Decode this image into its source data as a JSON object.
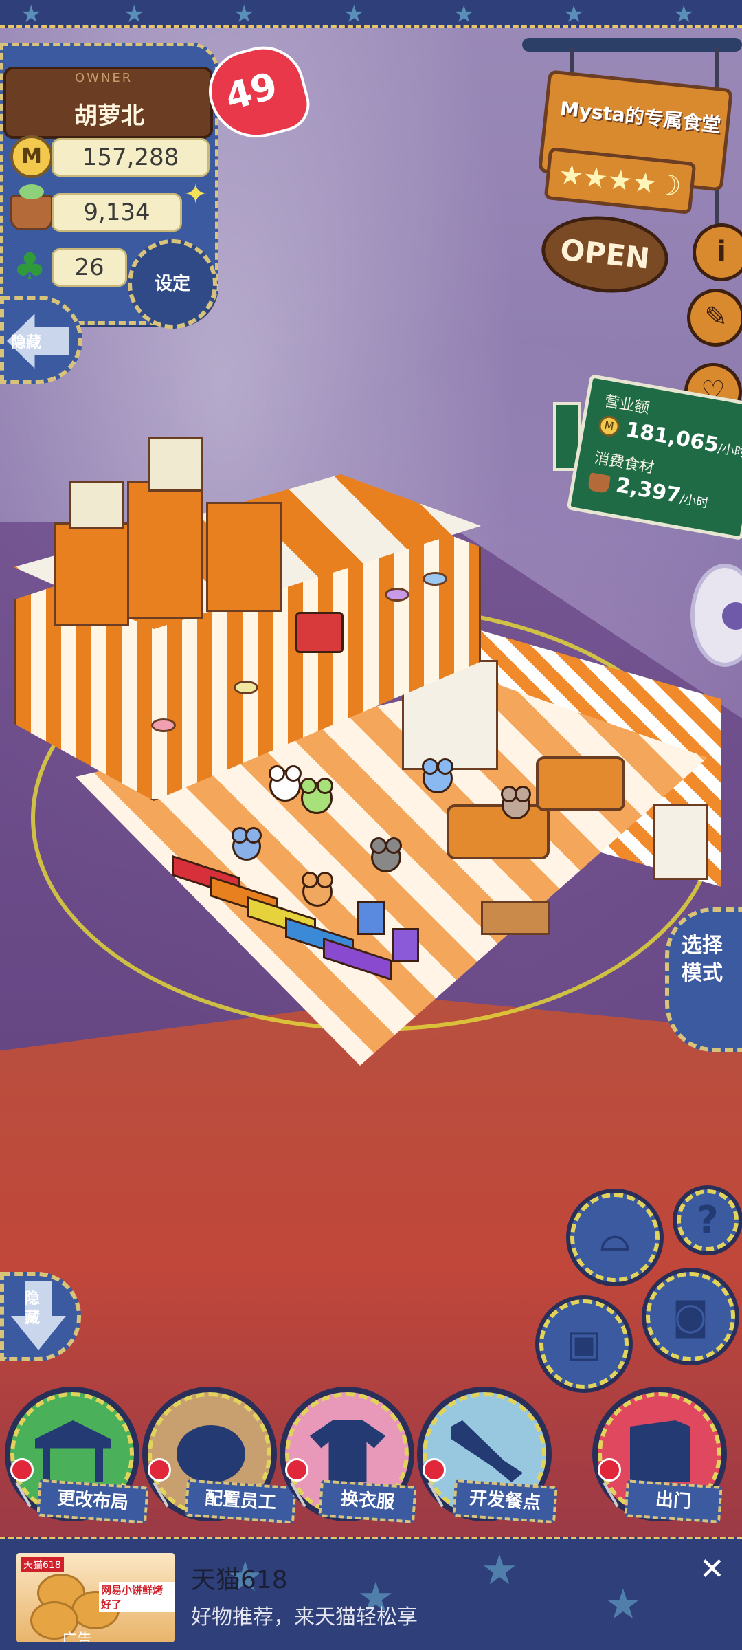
{
  "owner": {
    "label": "OWNER",
    "name": "胡萝北",
    "level": "49",
    "coins": "157,288",
    "ingredients": "9,134",
    "clovers": "26",
    "settings_label": "设定",
    "hide_label": "隐藏"
  },
  "restaurant": {
    "sign_title": "Mysta的专属食堂",
    "stars": "★★★★☽",
    "open_label": "OPEN"
  },
  "revenue": {
    "sales_label": "营业额",
    "sales_value": "181,065",
    "sales_unit": "/小时",
    "consume_label": "消费食材",
    "consume_value": "2,397",
    "consume_unit": "/小时"
  },
  "side_buttons": {
    "info": "i",
    "recipe": "✎",
    "heart": "♡"
  },
  "mode": {
    "label": "选择模式"
  },
  "bottom": {
    "hide_label": "隐藏",
    "help": "?",
    "menu": [
      {
        "label": "更改布局"
      },
      {
        "label": "配置员工"
      },
      {
        "label": "换衣服"
      },
      {
        "label": "开发餐点"
      },
      {
        "label": "出门"
      }
    ]
  },
  "ad": {
    "brand": "天猫618",
    "promo": "网易小饼鲜烤好了",
    "tag": "广告",
    "title": "天猫618",
    "subtitle": "好物推荐，来天猫轻松享",
    "close": "✕"
  },
  "colors": {
    "panel_blue": "#3b5aa0",
    "stitch_gold": "#d9c27a",
    "wood_orange": "#d98a2e",
    "sign_green": "#1f6b45",
    "heart_red": "#e8384a"
  }
}
